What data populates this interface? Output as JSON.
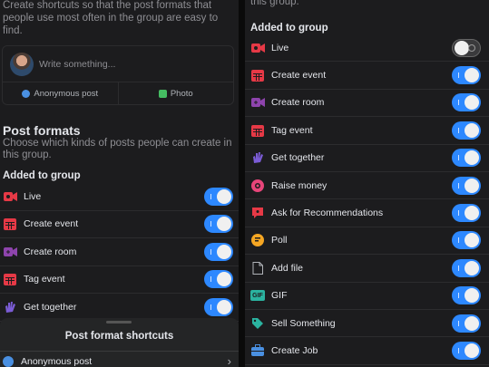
{
  "left": {
    "intro": "Create shortcuts so that the post formats that people use most often in the group are easy to find.",
    "composer": {
      "placeholder": "Write something...",
      "actions": [
        {
          "label": "Anonymous post",
          "icon": "anonymous-icon",
          "color": "#4a90e2"
        },
        {
          "label": "Photo",
          "icon": "photo-icon",
          "color": "#45bd62"
        }
      ]
    },
    "post_formats_title": "Post formats",
    "post_formats_desc": "Choose which kinds of posts people can create in this group.",
    "section": "Added to group",
    "items": [
      {
        "label": "Live",
        "icon": "live-icon",
        "color": "#e63946",
        "on": true
      },
      {
        "label": "Create event",
        "icon": "calendar-icon",
        "color": "#e63946",
        "on": true
      },
      {
        "label": "Create room",
        "icon": "video-plus-icon",
        "color": "#8e44ad",
        "on": true
      },
      {
        "label": "Tag event",
        "icon": "calendar-icon",
        "color": "#e63946",
        "on": true
      },
      {
        "label": "Get together",
        "icon": "hand-wave-icon",
        "color": "#7b5cd6",
        "on": true
      }
    ],
    "sheet": {
      "title": "Post format shortcuts",
      "row_label": "Anonymous post",
      "row_icon": "anonymous-icon",
      "chevron": "›"
    }
  },
  "right": {
    "top_text": "this group.",
    "section": "Added to group",
    "items": [
      {
        "label": "Live",
        "icon": "live-icon",
        "color": "#e63946",
        "on": false
      },
      {
        "label": "Create event",
        "icon": "calendar-icon",
        "color": "#e63946",
        "on": true
      },
      {
        "label": "Create room",
        "icon": "video-plus-icon",
        "color": "#8e44ad",
        "on": true
      },
      {
        "label": "Tag event",
        "icon": "calendar-icon",
        "color": "#e63946",
        "on": true
      },
      {
        "label": "Get together",
        "icon": "hand-wave-icon",
        "color": "#7b5cd6",
        "on": true
      },
      {
        "label": "Raise money",
        "icon": "fundraiser-icon",
        "color": "#e8457a",
        "on": true
      },
      {
        "label": "Ask for Recommendations",
        "icon": "recommendation-icon",
        "color": "#e63946",
        "on": true
      },
      {
        "label": "Poll",
        "icon": "poll-icon",
        "color": "#f5a623",
        "on": true
      },
      {
        "label": "Add file",
        "icon": "file-icon",
        "color": "#b0b3b8",
        "on": true
      },
      {
        "label": "GIF",
        "icon": "gif-icon",
        "color": "#2bb3a0",
        "on": true
      },
      {
        "label": "Sell Something",
        "icon": "tag-icon",
        "color": "#2bb3a0",
        "on": true
      },
      {
        "label": "Create Job",
        "icon": "briefcase-icon",
        "color": "#4a90e2",
        "on": true
      }
    ]
  },
  "colors": {
    "accent": "#2d88ff",
    "background": "#1c1c1e",
    "text": "#e4e6eb",
    "muted": "#8e8e93"
  },
  "gif_text": "GIF"
}
